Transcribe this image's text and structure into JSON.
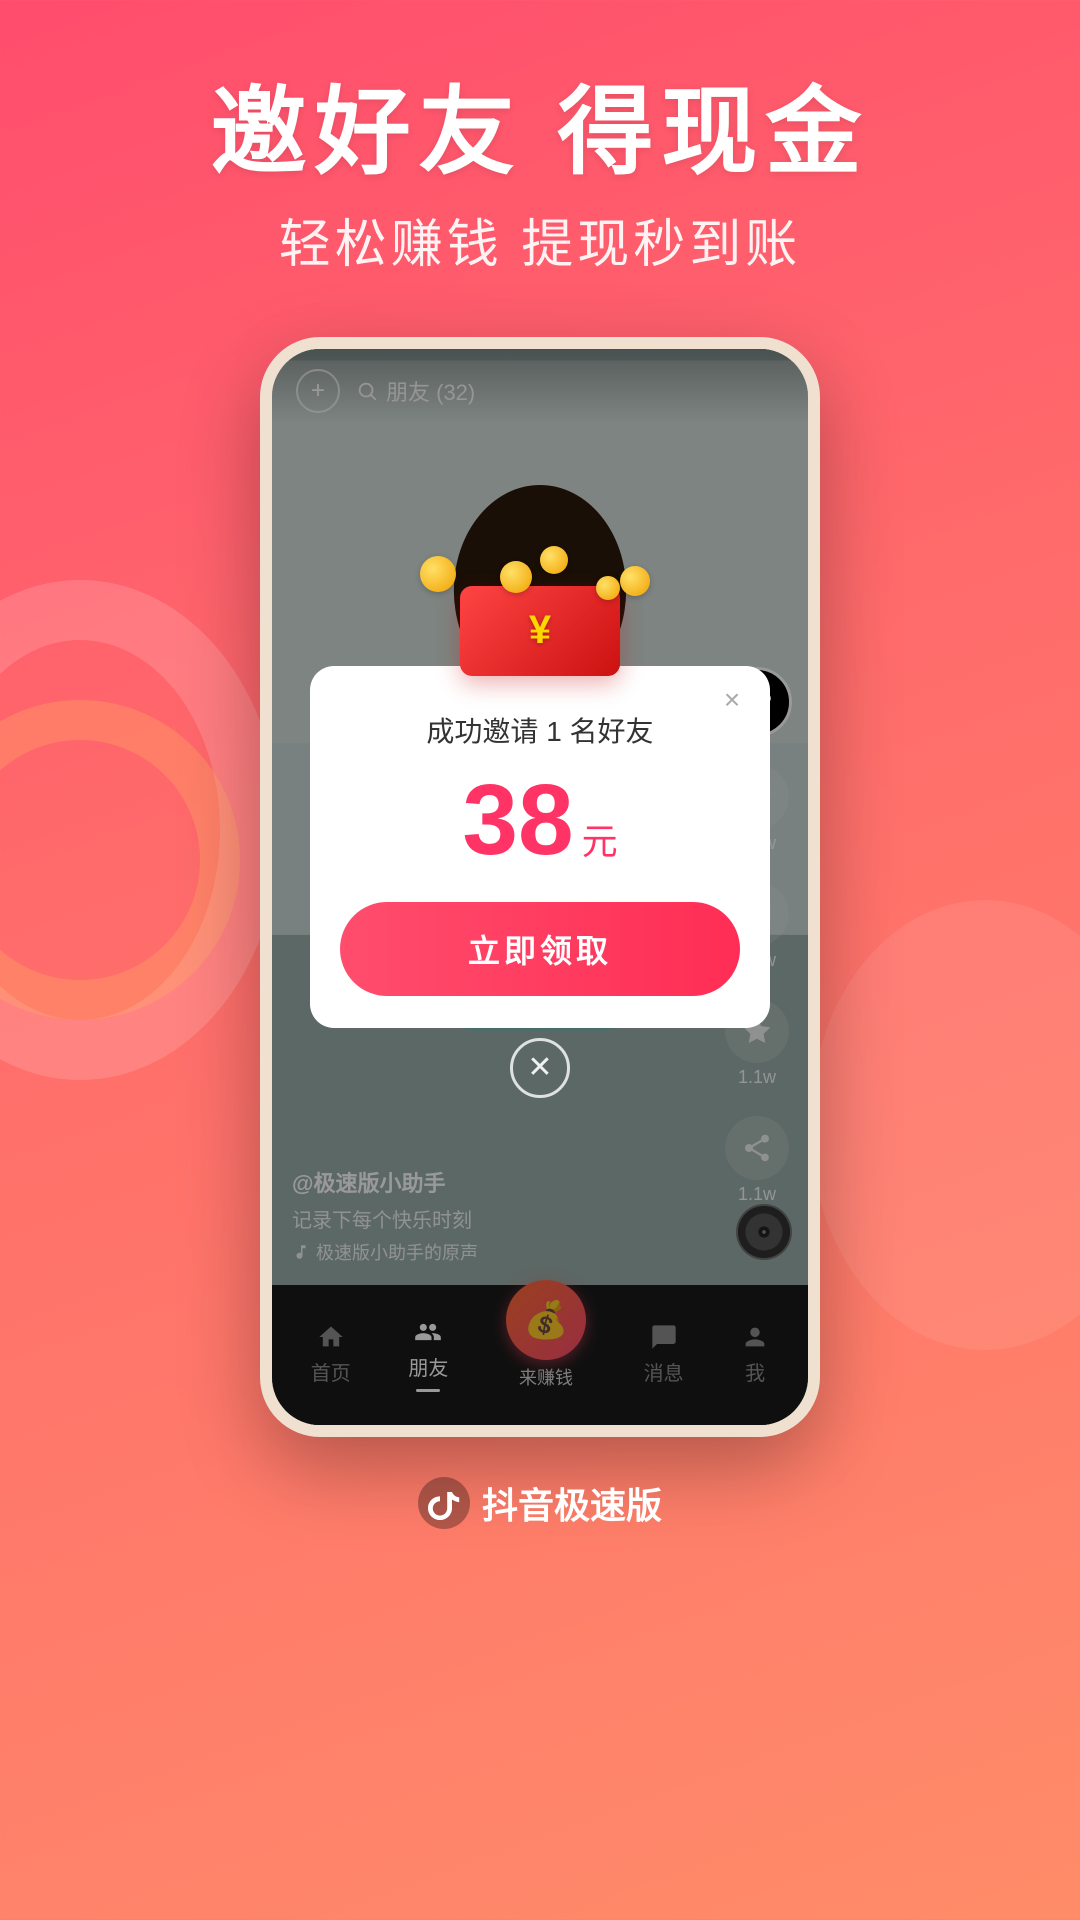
{
  "header": {
    "main_title": "邀好友 得现金",
    "sub_title": "轻松赚钱 提现秒到账"
  },
  "phone": {
    "top_bar": {
      "friend_label": "朋友 (32)",
      "add_icon": "plus-icon",
      "search_icon": "search-icon"
    },
    "right_sidebar": {
      "items": [
        {
          "icon": "❤",
          "label": "1.1w",
          "name": "like-count"
        },
        {
          "icon": "💬",
          "label": "1.1w",
          "name": "comment-count"
        },
        {
          "icon": "⭐",
          "label": "1.1w",
          "name": "collect-count"
        },
        {
          "icon": "↪",
          "label": "1.1w",
          "name": "share-count"
        }
      ]
    },
    "bottom_text": {
      "username": "@极速版小助手",
      "description": "记录下每个快乐时刻",
      "music": "🎵 极速版小助手的原声"
    },
    "bottom_nav": {
      "items": [
        {
          "label": "首页",
          "active": false
        },
        {
          "label": "朋友",
          "active": true
        },
        {
          "label": "来赚钱",
          "active": false,
          "special": true
        },
        {
          "label": "消息",
          "active": false
        },
        {
          "label": "我",
          "active": false
        }
      ]
    }
  },
  "modal": {
    "title": "成功邀请 1 名好友",
    "amount_number": "38",
    "amount_unit": "元",
    "claim_button_label": "立即领取",
    "close_icon": "×"
  },
  "footer": {
    "app_name": "抖音极速版",
    "logo_icon": "tiktok-logo-icon"
  },
  "colors": {
    "brand_gradient_start": "#ff4d6d",
    "brand_gradient_end": "#ff8c69",
    "accent_red": "#ff3366",
    "white": "#ffffff"
  }
}
